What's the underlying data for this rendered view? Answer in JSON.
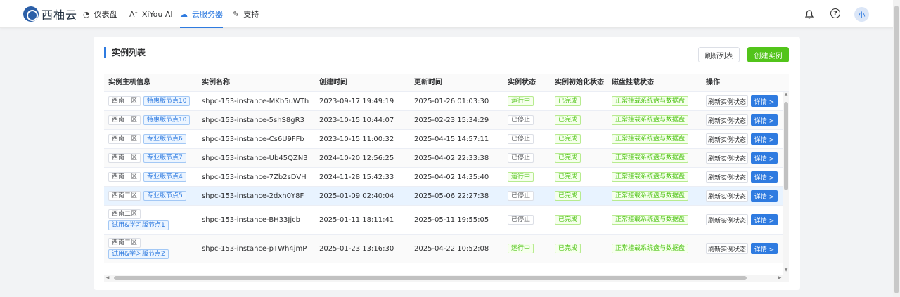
{
  "brand": {
    "name": "西柚云"
  },
  "nav": [
    {
      "label": "仪表盘",
      "icon": "dashboard-icon",
      "glyph": "◔"
    },
    {
      "label": "XiYou AI",
      "icon": "ai-icon",
      "glyph": "Aᐩ"
    },
    {
      "label": "云服务器",
      "icon": "cloud-icon",
      "glyph": "☁",
      "active": true
    },
    {
      "label": "支持",
      "icon": "wrench-icon",
      "glyph": "✎"
    }
  ],
  "user": {
    "avatar_text": "小"
  },
  "page": {
    "title": "实例列表",
    "refresh_label": "刷新列表",
    "create_label": "创建实例"
  },
  "table": {
    "columns": [
      "实例主机信息",
      "实例名称",
      "创建时间",
      "更新时间",
      "实例状态",
      "实例初始化状态",
      "磁盘挂载状态",
      "操作"
    ],
    "row_actions": {
      "refresh": "刷新实例状态",
      "detail": "详情 >"
    },
    "rows": [
      {
        "region": "西南一区",
        "node": "特惠版节点10",
        "name": "shpc-153-instance-MKb5uWTh",
        "created": "2023-09-17 19:49:19",
        "updated": "2025-01-26 01:03:30",
        "status": "运行中",
        "init": "已完成",
        "disk": "正常挂载系统盘与数据盘"
      },
      {
        "region": "西南一区",
        "node": "特惠版节点10",
        "name": "shpc-153-instance-5shS8gR3",
        "created": "2023-10-15 10:44:07",
        "updated": "2025-02-23 15:34:29",
        "status": "已停止",
        "init": "已完成",
        "disk": "正常挂载系统盘与数据盘"
      },
      {
        "region": "西南一区",
        "node": "专业版节点6",
        "name": "shpc-153-instance-Cs6U9FFb",
        "created": "2023-10-15 11:00:32",
        "updated": "2025-04-15 14:57:11",
        "status": "已停止",
        "init": "已完成",
        "disk": "正常挂载系统盘与数据盘"
      },
      {
        "region": "西南一区",
        "node": "专业版节点7",
        "name": "shpc-153-instance-Ub45QZN3",
        "created": "2024-10-20 12:56:25",
        "updated": "2025-04-02 22:33:38",
        "status": "已停止",
        "init": "已完成",
        "disk": "正常挂载系统盘与数据盘"
      },
      {
        "region": "西南一区",
        "node": "专业版节点4",
        "name": "shpc-153-instance-7Zb2sDVH",
        "created": "2024-11-28 15:42:33",
        "updated": "2025-04-02 14:35:40",
        "status": "运行中",
        "init": "已完成",
        "disk": "正常挂载系统盘与数据盘"
      },
      {
        "region": "西南二区",
        "node": "专业版节点5",
        "name": "shpc-153-instance-2dxh0Y8F",
        "created": "2025-01-09 02:40:04",
        "updated": "2025-05-06 22:27:38",
        "status": "已停止",
        "init": "已完成",
        "disk": "正常挂载系统盘与数据盘"
      },
      {
        "region": "西南二区",
        "node": "试用&学习版节点1",
        "name": "shpc-153-instance-BH33Jjcb",
        "created": "2025-01-11 18:11:41",
        "updated": "2025-05-11 19:55:05",
        "status": "已停止",
        "init": "已完成",
        "disk": "正常挂载系统盘与数据盘"
      },
      {
        "region": "西南二区",
        "node": "试用&学习版节点2",
        "name": "shpc-153-instance-pTWh4jmP",
        "created": "2025-01-23 13:16:30",
        "updated": "2025-04-22 10:52:08",
        "status": "运行中",
        "init": "已完成",
        "disk": "正常挂载系统盘与数据盘"
      }
    ]
  }
}
